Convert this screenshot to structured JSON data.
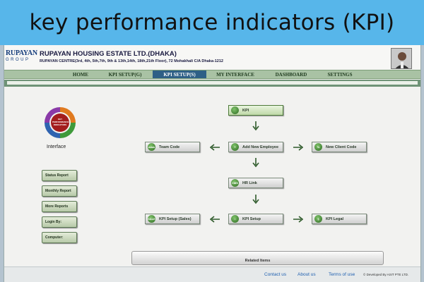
{
  "banner": {
    "title": "key performance indicators (KPI)"
  },
  "header": {
    "logo_top": "RUPAYAN",
    "logo_bottom": "GROUP",
    "company": "RUPAYAN HOUSING ESTATE LTD.(DHAKA)",
    "address": "RUPAYAN CENTRE(3rd, 4th, 5th,7th, 9th & 13th,14th, 18th,21th Floor), 72 Mohakhali C/A Dhaka-1212"
  },
  "nav": {
    "items": [
      {
        "label": "HOME"
      },
      {
        "label": "KPI SETUP(G)"
      },
      {
        "label": "KPI SETUP(S)"
      },
      {
        "label": "MY INTERFACE"
      },
      {
        "label": "DASHBOARD"
      },
      {
        "label": "SETTINGS"
      }
    ],
    "active": "KPI SETUP(S)"
  },
  "side": {
    "logo_text": "KEY PERFORMANCE INDICATORS",
    "interface_label": "Interface",
    "buttons": [
      {
        "label": "Status Report"
      },
      {
        "label": "Monthly Report"
      },
      {
        "label": "More Reports"
      },
      {
        "label": "Login By:"
      },
      {
        "label": "Computer:"
      }
    ]
  },
  "flow": {
    "kpi": {
      "label": "KPI",
      "icon": "kpi-icon"
    },
    "team_code": {
      "label": "Team Code",
      "icon": "www-icon",
      "icon_text": "www"
    },
    "add_employee": {
      "label": "Add New Employee",
      "icon": "add-user-icon"
    },
    "new_client": {
      "label": "New Client Code",
      "icon": "percent-icon",
      "icon_text": "%"
    },
    "hr_link": {
      "label": "HR Link",
      "icon": "hr-icon",
      "icon_text": "CMS"
    },
    "kpi_setup_sales": {
      "label": "KPI Setup (Sales)",
      "icon": "sales-icon",
      "icon_text": "SALE"
    },
    "kpi_setup": {
      "label": "KPI Setup",
      "icon": "house-icon"
    },
    "kpi_legal": {
      "label": "KPI Legal",
      "icon": "legal-icon"
    }
  },
  "related": {
    "label": "Related Items"
  },
  "footer": {
    "contact": "Contact us",
    "about": "About us",
    "terms": "Terms of use",
    "developed": "© Developed By ASIT PTE LTD."
  },
  "colors": {
    "banner": "#57b6ea",
    "nav_active": "#2e5f86",
    "nav_bar": "#a9c2a4",
    "accent_green": "#2e6a22"
  }
}
